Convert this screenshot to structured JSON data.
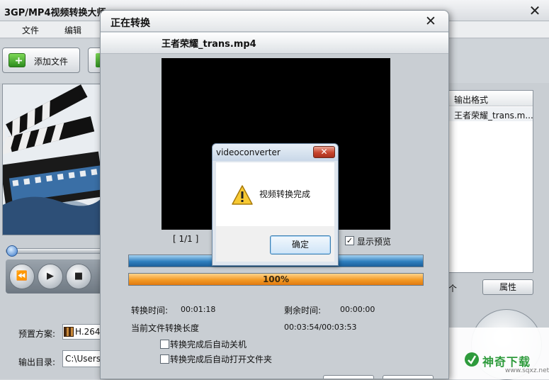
{
  "main": {
    "title": "3GP/MP4视频转换大师",
    "menu": [
      "文件",
      "编辑"
    ],
    "toolbar": {
      "add_file_label": "添加文件"
    },
    "player_buttons": [
      "⏪",
      "▶",
      "■"
    ],
    "preset_label": "预置方案:",
    "preset_value": "H.264/",
    "output_dir_label": "输出目录:",
    "output_dir_value": "C:\\Users",
    "file_list": {
      "header": "输出格式",
      "rows": [
        "王者荣耀_trans.m..."
      ]
    },
    "partial_button_label": "个",
    "properties_button_label": "属性"
  },
  "convert_dialog": {
    "title": "正在转换",
    "file_name": "王者荣耀_trans.mp4",
    "page_counter": "[ 1/1 ]",
    "show_preview_label": "显示预览",
    "show_preview_checked": true,
    "file_progress": 1.0,
    "total_progress": 1.0,
    "total_progress_text": "100%",
    "elapsed_label": "转换时间:",
    "elapsed_value": "00:01:18",
    "remaining_label": "剩余时间:",
    "remaining_value": "00:00:00",
    "length_label": "当前文件转换长度",
    "length_value": "00:03:54/00:03:53",
    "auto_shutdown_label": "转换完成后自动关机",
    "auto_open_folder_label": "转换完成后自动打开文件夹"
  },
  "message_box": {
    "title": "videoconverter",
    "text": "视频转换完成",
    "ok_label": "确定",
    "icon": "warning-icon"
  },
  "watermark": {
    "text": "神奇下载",
    "url": "www.sqxz.net"
  }
}
